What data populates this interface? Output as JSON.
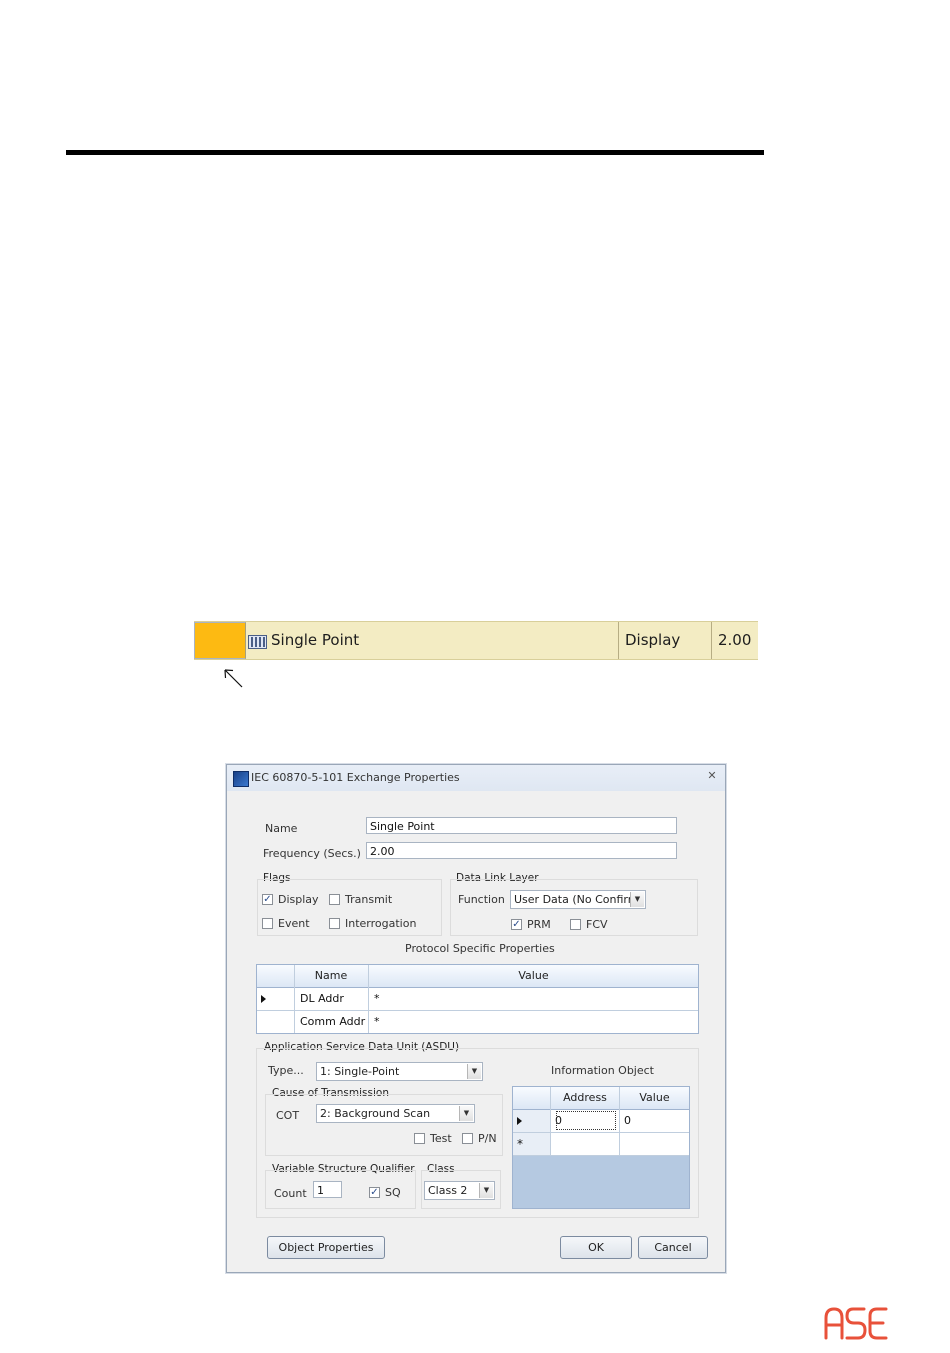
{
  "row": {
    "name": "Single Point",
    "flag": "Display",
    "frequency": "2.00",
    "colors": {
      "selector": "#fdba12",
      "row_bg": "#f3ecc3"
    }
  },
  "dialog": {
    "title": "IEC 60870-5-101 Exchange Properties",
    "close_glyph": "✕",
    "name_label": "Name",
    "name_value": "Single Point",
    "frequency_label": "Frequency (Secs.)",
    "frequency_value": "2.00",
    "flags": {
      "title": "Flags",
      "display": {
        "label": "Display",
        "checked": true
      },
      "transmit": {
        "label": "Transmit",
        "checked": false
      },
      "event": {
        "label": "Event",
        "checked": false
      },
      "interrogation": {
        "label": "Interrogation",
        "checked": false
      }
    },
    "data_link": {
      "title": "Data Link Layer",
      "function_label": "Function",
      "function_value": "User Data (No Confirm",
      "prm": {
        "label": "PRM",
        "checked": true
      },
      "fcv": {
        "label": "FCV",
        "checked": false
      }
    },
    "protocol": {
      "title": "Protocol Specific Properties",
      "columns": [
        "Name",
        "Value"
      ],
      "rows": [
        {
          "name": "DL Addr",
          "value": "*"
        },
        {
          "name": "Comm Addr",
          "value": "*"
        }
      ]
    },
    "asdu": {
      "title": "Application Service Data Unit (ASDU)",
      "type_label": "Type...",
      "type_value": "1: Single-Point",
      "cot_group": "Cause of Transmission",
      "cot_label": "COT",
      "cot_value": "2: Background Scan",
      "test": {
        "label": "Test",
        "checked": false
      },
      "pn": {
        "label": "P/N",
        "checked": false
      },
      "vsq_group": "Variable Structure Qualifier",
      "count_label": "Count",
      "count_value": "1",
      "sq": {
        "label": "SQ",
        "checked": true
      },
      "class_group": "Class",
      "class_value": "Class 2",
      "info_object": {
        "title": "Information Object",
        "columns": [
          "Address",
          "Value"
        ],
        "rows": [
          {
            "address": "0",
            "value": "0"
          }
        ],
        "new_row_marker": "*"
      }
    },
    "buttons": {
      "object_properties": "Object Properties",
      "ok": "OK",
      "cancel": "Cancel"
    }
  },
  "logo": {
    "text": "ASE",
    "color": "#e8513a"
  }
}
